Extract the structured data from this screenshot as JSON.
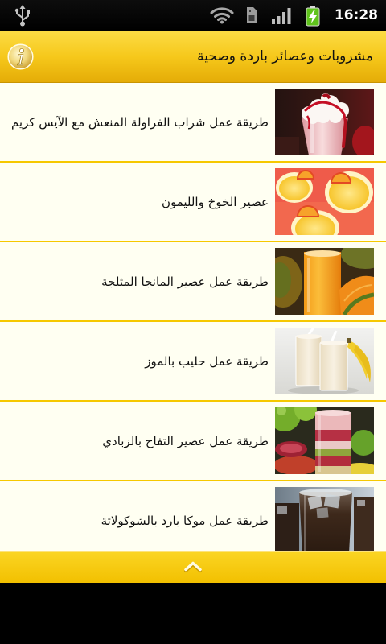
{
  "status_bar": {
    "time": "16:28",
    "icons": [
      "usb-icon",
      "wifi-icon",
      "sim-card-icon",
      "signal-icon",
      "battery-charging-icon"
    ]
  },
  "header": {
    "title": "مشروبات وعصائر باردة وصحية",
    "info_icon": "info-icon"
  },
  "list": {
    "items": [
      {
        "title": "طريقة عمل شراب الفراولة المنعش مع الآيس كريم"
      },
      {
        "title": "عصير الخوخ والليمون"
      },
      {
        "title": "طريقة عمل عصير المانجا المثلجة"
      },
      {
        "title": "طريقة عمل حليب بالموز"
      },
      {
        "title": "طريقة عمل عصير التفاح بالزبادي"
      },
      {
        "title": "طريقة عمل موكا بارد بالشوكولاتة"
      }
    ]
  },
  "footer": {
    "scroll_icon": "chevron-up-icon"
  },
  "colors": {
    "accent": "#f6c800",
    "list_background": "#fffff0",
    "status_bar": "#000000",
    "battery": "#5fc31c"
  }
}
